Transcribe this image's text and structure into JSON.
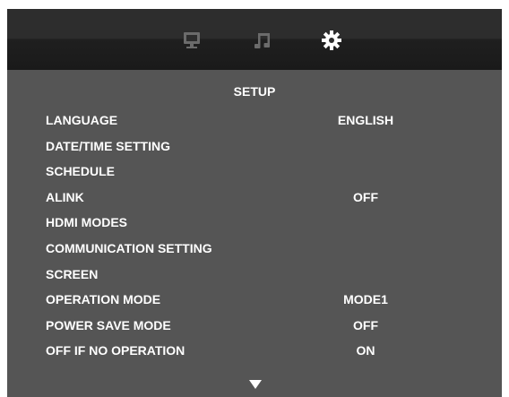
{
  "tabs": [
    {
      "icon": "monitor-icon",
      "active": false
    },
    {
      "icon": "music-note-icon",
      "active": false
    },
    {
      "icon": "gear-icon",
      "active": true
    }
  ],
  "title": "SETUP",
  "menu": [
    {
      "label": "LANGUAGE",
      "value": "ENGLISH"
    },
    {
      "label": "DATE/TIME SETTING",
      "value": ""
    },
    {
      "label": "SCHEDULE",
      "value": ""
    },
    {
      "label": "ALINK",
      "value": "OFF"
    },
    {
      "label": "HDMI MODES",
      "value": ""
    },
    {
      "label": "COMMUNICATION SETTING",
      "value": ""
    },
    {
      "label": "SCREEN",
      "value": ""
    },
    {
      "label": "OPERATION MODE",
      "value": "MODE1"
    },
    {
      "label": "POWER SAVE MODE",
      "value": "OFF"
    },
    {
      "label": "OFF IF NO OPERATION",
      "value": "ON"
    }
  ],
  "colors": {
    "panel": "#555555",
    "topbar": "#2d2d2d",
    "inactive_icon": "#6b6b6b",
    "active_icon": "#ffffff",
    "text": "#ffffff"
  }
}
